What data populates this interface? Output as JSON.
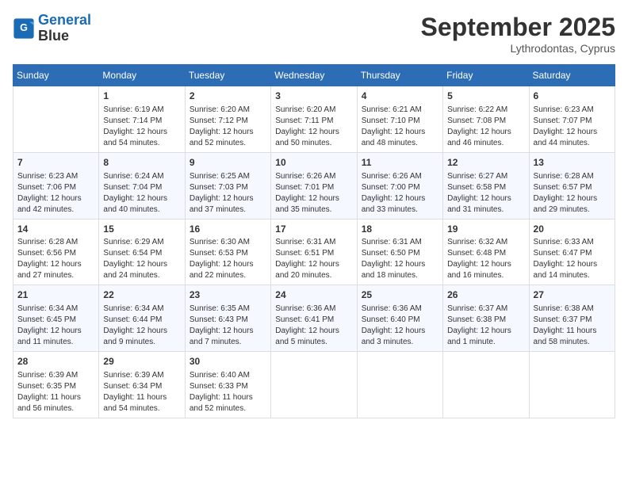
{
  "header": {
    "logo_line1": "General",
    "logo_line2": "Blue",
    "month_title": "September 2025",
    "subtitle": "Lythrodontas, Cyprus"
  },
  "days_of_week": [
    "Sunday",
    "Monday",
    "Tuesday",
    "Wednesday",
    "Thursday",
    "Friday",
    "Saturday"
  ],
  "weeks": [
    [
      {
        "day": "",
        "info": ""
      },
      {
        "day": "1",
        "info": "Sunrise: 6:19 AM\nSunset: 7:14 PM\nDaylight: 12 hours\nand 54 minutes."
      },
      {
        "day": "2",
        "info": "Sunrise: 6:20 AM\nSunset: 7:12 PM\nDaylight: 12 hours\nand 52 minutes."
      },
      {
        "day": "3",
        "info": "Sunrise: 6:20 AM\nSunset: 7:11 PM\nDaylight: 12 hours\nand 50 minutes."
      },
      {
        "day": "4",
        "info": "Sunrise: 6:21 AM\nSunset: 7:10 PM\nDaylight: 12 hours\nand 48 minutes."
      },
      {
        "day": "5",
        "info": "Sunrise: 6:22 AM\nSunset: 7:08 PM\nDaylight: 12 hours\nand 46 minutes."
      },
      {
        "day": "6",
        "info": "Sunrise: 6:23 AM\nSunset: 7:07 PM\nDaylight: 12 hours\nand 44 minutes."
      }
    ],
    [
      {
        "day": "7",
        "info": "Sunrise: 6:23 AM\nSunset: 7:06 PM\nDaylight: 12 hours\nand 42 minutes."
      },
      {
        "day": "8",
        "info": "Sunrise: 6:24 AM\nSunset: 7:04 PM\nDaylight: 12 hours\nand 40 minutes."
      },
      {
        "day": "9",
        "info": "Sunrise: 6:25 AM\nSunset: 7:03 PM\nDaylight: 12 hours\nand 37 minutes."
      },
      {
        "day": "10",
        "info": "Sunrise: 6:26 AM\nSunset: 7:01 PM\nDaylight: 12 hours\nand 35 minutes."
      },
      {
        "day": "11",
        "info": "Sunrise: 6:26 AM\nSunset: 7:00 PM\nDaylight: 12 hours\nand 33 minutes."
      },
      {
        "day": "12",
        "info": "Sunrise: 6:27 AM\nSunset: 6:58 PM\nDaylight: 12 hours\nand 31 minutes."
      },
      {
        "day": "13",
        "info": "Sunrise: 6:28 AM\nSunset: 6:57 PM\nDaylight: 12 hours\nand 29 minutes."
      }
    ],
    [
      {
        "day": "14",
        "info": "Sunrise: 6:28 AM\nSunset: 6:56 PM\nDaylight: 12 hours\nand 27 minutes."
      },
      {
        "day": "15",
        "info": "Sunrise: 6:29 AM\nSunset: 6:54 PM\nDaylight: 12 hours\nand 24 minutes."
      },
      {
        "day": "16",
        "info": "Sunrise: 6:30 AM\nSunset: 6:53 PM\nDaylight: 12 hours\nand 22 minutes."
      },
      {
        "day": "17",
        "info": "Sunrise: 6:31 AM\nSunset: 6:51 PM\nDaylight: 12 hours\nand 20 minutes."
      },
      {
        "day": "18",
        "info": "Sunrise: 6:31 AM\nSunset: 6:50 PM\nDaylight: 12 hours\nand 18 minutes."
      },
      {
        "day": "19",
        "info": "Sunrise: 6:32 AM\nSunset: 6:48 PM\nDaylight: 12 hours\nand 16 minutes."
      },
      {
        "day": "20",
        "info": "Sunrise: 6:33 AM\nSunset: 6:47 PM\nDaylight: 12 hours\nand 14 minutes."
      }
    ],
    [
      {
        "day": "21",
        "info": "Sunrise: 6:34 AM\nSunset: 6:45 PM\nDaylight: 12 hours\nand 11 minutes."
      },
      {
        "day": "22",
        "info": "Sunrise: 6:34 AM\nSunset: 6:44 PM\nDaylight: 12 hours\nand 9 minutes."
      },
      {
        "day": "23",
        "info": "Sunrise: 6:35 AM\nSunset: 6:43 PM\nDaylight: 12 hours\nand 7 minutes."
      },
      {
        "day": "24",
        "info": "Sunrise: 6:36 AM\nSunset: 6:41 PM\nDaylight: 12 hours\nand 5 minutes."
      },
      {
        "day": "25",
        "info": "Sunrise: 6:36 AM\nSunset: 6:40 PM\nDaylight: 12 hours\nand 3 minutes."
      },
      {
        "day": "26",
        "info": "Sunrise: 6:37 AM\nSunset: 6:38 PM\nDaylight: 12 hours\nand 1 minute."
      },
      {
        "day": "27",
        "info": "Sunrise: 6:38 AM\nSunset: 6:37 PM\nDaylight: 11 hours\nand 58 minutes."
      }
    ],
    [
      {
        "day": "28",
        "info": "Sunrise: 6:39 AM\nSunset: 6:35 PM\nDaylight: 11 hours\nand 56 minutes."
      },
      {
        "day": "29",
        "info": "Sunrise: 6:39 AM\nSunset: 6:34 PM\nDaylight: 11 hours\nand 54 minutes."
      },
      {
        "day": "30",
        "info": "Sunrise: 6:40 AM\nSunset: 6:33 PM\nDaylight: 11 hours\nand 52 minutes."
      },
      {
        "day": "",
        "info": ""
      },
      {
        "day": "",
        "info": ""
      },
      {
        "day": "",
        "info": ""
      },
      {
        "day": "",
        "info": ""
      }
    ]
  ]
}
